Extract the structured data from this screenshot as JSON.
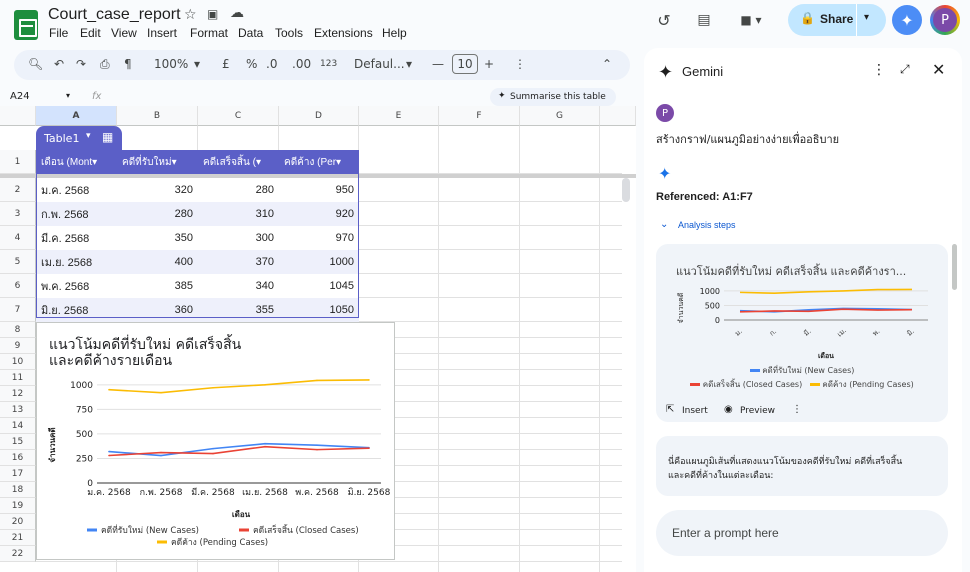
{
  "header": {
    "title": "Court_case_report",
    "menus": [
      "File",
      "Edit",
      "View",
      "Insert",
      "Format",
      "Data",
      "Tools",
      "Extensions",
      "Help"
    ],
    "share_label": "Share",
    "avatar_letter": "P"
  },
  "toolbar": {
    "zoom": "100%",
    "currency": "£",
    "percent": "%",
    "dec_dec": ".0",
    "dec_inc": ".00",
    "num_format": "123",
    "font": "Defaul...",
    "font_size": "10"
  },
  "formula_bar": {
    "cell_ref": "A24",
    "fx": "fx",
    "summarise": "Summarise this table"
  },
  "columns": [
    "A",
    "B",
    "C",
    "D",
    "E",
    "F",
    "G"
  ],
  "rows": [
    "1",
    "2",
    "3",
    "4",
    "5",
    "6",
    "7",
    "8",
    "9",
    "10",
    "11",
    "12",
    "13",
    "14",
    "15",
    "16",
    "17",
    "18",
    "19",
    "20",
    "21",
    "22"
  ],
  "table": {
    "name": "Table1",
    "headers": [
      "เดือน (Mont",
      "คดีที่รับใหม่",
      "คดีเสร็จสิ้น (",
      "คดีค้าง (Per"
    ],
    "rows": [
      [
        "ม.ค. 2568",
        "320",
        "280",
        "950"
      ],
      [
        "ก.พ. 2568",
        "280",
        "310",
        "920"
      ],
      [
        "มี.ค. 2568",
        "350",
        "300",
        "970"
      ],
      [
        "เม.ย. 2568",
        "400",
        "370",
        "1000"
      ],
      [
        "พ.ค. 2568",
        "385",
        "340",
        "1045"
      ],
      [
        "มิ.ย. 2568",
        "360",
        "355",
        "1050"
      ]
    ]
  },
  "chart_data": {
    "type": "line",
    "title": "แนวโน้มคดีที่รับใหม่ คดีเสร็จสิ้น และคดีค้างรายเดือน",
    "title_line1": "แนวโน้มคดีที่รับใหม่ คดีเสร็จสิ้น",
    "title_line2": "และคดีค้างรายเดือน",
    "xlabel": "เดือน",
    "ylabel": "จำนวนคดี",
    "categories": [
      "ม.ค. 2568",
      "ก.พ. 2568",
      "มี.ค. 2568",
      "เม.ย. 2568",
      "พ.ค. 2568",
      "มิ.ย. 2568"
    ],
    "yticks": [
      "0",
      "250",
      "500",
      "750",
      "1000"
    ],
    "ylim": [
      0,
      1100
    ],
    "series": [
      {
        "name": "คดีที่รับใหม่ (New Cases)",
        "color": "#4285f4",
        "values": [
          320,
          280,
          350,
          400,
          385,
          360
        ]
      },
      {
        "name": "คดีเสร็จสิ้น (Closed Cases)",
        "color": "#ea4335",
        "values": [
          280,
          310,
          300,
          370,
          340,
          355
        ]
      },
      {
        "name": "คดีค้าง (Pending Cases)",
        "color": "#fbbc04",
        "values": [
          950,
          920,
          970,
          1000,
          1045,
          1050
        ]
      }
    ],
    "legend": "bottom",
    "grid": true
  },
  "gemini": {
    "title": "Gemini",
    "avatar": "P",
    "prompt": "สร้างกราฟ/แผนภูมิอย่างง่ายเพื่ออธิบาย",
    "referenced": "Referenced: A1:F7",
    "analysis": "Analysis steps",
    "preview_title": "แนวโน้มคดีที่รับใหม่ คดีเสร็จสิ้น และคดีค้างรา...",
    "preview_yticks": [
      "1000",
      "500",
      "0"
    ],
    "preview_xticks": [
      "ม.",
      "ก.",
      "มี.",
      "เม.",
      "พ.",
      "มิ."
    ],
    "preview_ylabel": "จำนวนคดี",
    "preview_xlabel": "เดือน",
    "preview_legend": [
      "คดีที่รับใหม่ (New Cases)",
      "คดีเสร็จสิ้น (Closed Cases)",
      "คดีค้าง (Pending Cases)"
    ],
    "insert": "Insert",
    "preview": "Preview",
    "response_line1": "นี่คือแผนภูมิเส้นที่แสดงแนวโน้มของคดีที่รับใหม่ คดีที่เสร็จสิ้น",
    "response_line2": "และคดีที่ค้างในแต่ละเดือน:",
    "input_placeholder": "Enter a prompt here"
  }
}
